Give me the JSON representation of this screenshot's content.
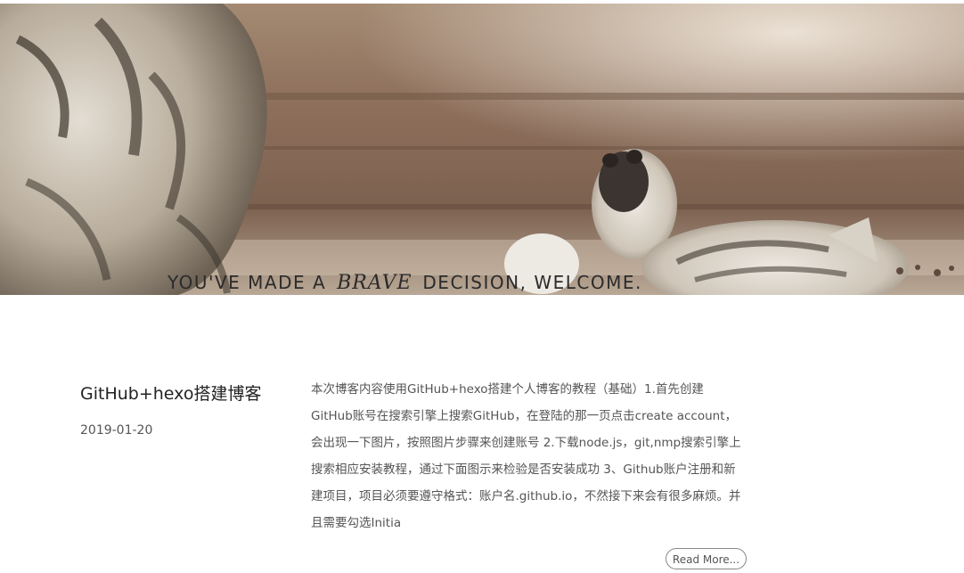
{
  "hero": {
    "tagline_before": "YOU'VE MADE A",
    "tagline_emphasis": "BRAVE",
    "tagline_after": "DECISION, WELCOME."
  },
  "post": {
    "title": "GitHub+hexo搭建博客",
    "date": "2019-01-20",
    "excerpt": "本次博客内容使用GitHub+hexo搭建个人博客的教程（基础）1.首先创建GitHub账号在搜索引擎上搜索GitHub，在登陆的那一页点击create account，会出现一下图片，按照图片步骤来创建账号 2.下载node.js，git,nmp搜索引擎上搜索相应安装教程，通过下面图示来检验是否安装成功 3、Github账户注册和新建项目，项目必须要遵守格式：账户名.github.io，不然接下来会有很多麻烦。并且需要勾选Initia",
    "read_more_label": "Read More..."
  }
}
